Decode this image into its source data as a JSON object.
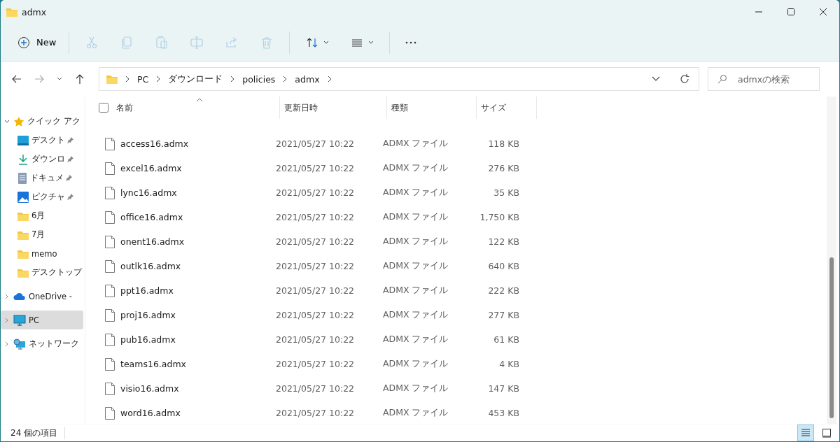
{
  "window": {
    "title": "admx"
  },
  "toolbar": {
    "new_label": "New",
    "edit_tools": [
      {
        "disabled": true
      },
      {
        "disabled": true
      },
      {
        "disabled": true
      },
      {
        "disabled": true
      },
      {
        "disabled": true
      },
      {
        "disabled": true
      }
    ],
    "view_tools": [
      {
        "dropdown": true
      },
      {
        "dropdown": true
      },
      {
        "dropdown": false
      }
    ]
  },
  "navigation": {
    "back_disabled": false,
    "forward_disabled": true
  },
  "address_bar": {
    "crumbs": [
      "PC",
      "ダウンロード",
      "policies",
      "admx"
    ]
  },
  "search": {
    "placeholder": "admxの検索"
  },
  "sidebar": {
    "items": [
      {
        "label": "クイック アク",
        "kind": "quick",
        "expanded": true,
        "selected": false,
        "children": [
          {
            "label": "デスクト",
            "kind": "desktop",
            "pinned": true,
            "selected": false
          },
          {
            "label": "ダウンロ",
            "kind": "download",
            "pinned": true,
            "selected": false
          },
          {
            "label": "ドキュメ",
            "kind": "document",
            "pinned": true,
            "selected": false
          },
          {
            "label": "ピクチャ",
            "kind": "picture-lib",
            "pinned": true,
            "selected": false
          },
          {
            "label": "6月",
            "kind": "folder",
            "pinned": false,
            "selected": false
          },
          {
            "label": "7月",
            "kind": "folder",
            "pinned": false,
            "selected": false
          },
          {
            "label": "memo",
            "kind": "folder",
            "pinned": false,
            "selected": false
          },
          {
            "label": "デスクトップ",
            "kind": "folder",
            "pinned": false,
            "selected": false
          }
        ]
      },
      {
        "label": "OneDrive -",
        "kind": "cloud",
        "expanded": false,
        "selected": false
      },
      {
        "label": "PC",
        "kind": "pc",
        "expanded": false,
        "selected": true
      },
      {
        "label": "ネットワーク",
        "kind": "network",
        "expanded": false,
        "selected": false
      }
    ]
  },
  "table": {
    "select_all_checked": false,
    "columns": [
      {
        "label": "名前",
        "sorted": true
      },
      {
        "label": "更新日時",
        "sorted": false
      },
      {
        "label": "種類",
        "sorted": false
      },
      {
        "label": "サイズ",
        "sorted": false
      }
    ],
    "rows": [
      {
        "kind": "file",
        "name": "access16.admx",
        "date": "2021/05/27 10:22",
        "type": "ADMX ファイル",
        "size": "118 KB"
      },
      {
        "kind": "file",
        "name": "excel16.admx",
        "date": "2021/05/27 10:22",
        "type": "ADMX ファイル",
        "size": "276 KB"
      },
      {
        "kind": "file",
        "name": "lync16.admx",
        "date": "2021/05/27 10:22",
        "type": "ADMX ファイル",
        "size": "35 KB"
      },
      {
        "kind": "file",
        "name": "office16.admx",
        "date": "2021/05/27 10:22",
        "type": "ADMX ファイル",
        "size": "1,750 KB"
      },
      {
        "kind": "file",
        "name": "onent16.admx",
        "date": "2021/05/27 10:22",
        "type": "ADMX ファイル",
        "size": "122 KB"
      },
      {
        "kind": "file",
        "name": "outlk16.admx",
        "date": "2021/05/27 10:22",
        "type": "ADMX ファイル",
        "size": "640 KB"
      },
      {
        "kind": "file",
        "name": "ppt16.admx",
        "date": "2021/05/27 10:22",
        "type": "ADMX ファイル",
        "size": "222 KB"
      },
      {
        "kind": "file",
        "name": "proj16.admx",
        "date": "2021/05/27 10:22",
        "type": "ADMX ファイル",
        "size": "277 KB"
      },
      {
        "kind": "file",
        "name": "pub16.admx",
        "date": "2021/05/27 10:22",
        "type": "ADMX ファイル",
        "size": "61 KB"
      },
      {
        "kind": "file",
        "name": "teams16.admx",
        "date": "2021/05/27 10:22",
        "type": "ADMX ファイル",
        "size": "4 KB"
      },
      {
        "kind": "file",
        "name": "visio16.admx",
        "date": "2021/05/27 10:22",
        "type": "ADMX ファイル",
        "size": "147 KB"
      },
      {
        "kind": "file",
        "name": "word16.admx",
        "date": "2021/05/27 10:22",
        "type": "ADMX ファイル",
        "size": "453 KB"
      }
    ]
  },
  "status_bar": {
    "item_count": "24 個の項目",
    "views": [
      {
        "selected": true
      },
      {
        "selected": false
      }
    ]
  }
}
